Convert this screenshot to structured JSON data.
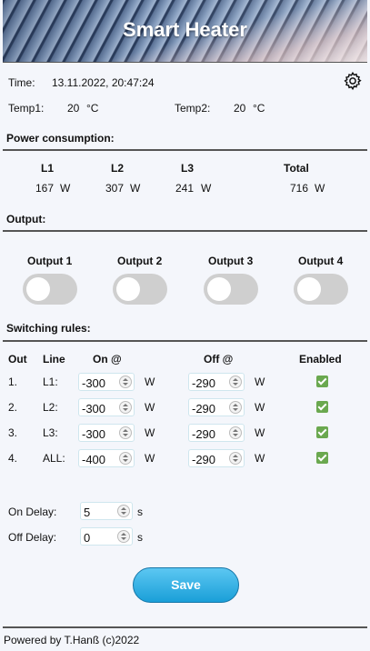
{
  "header": {
    "title": "Smart Heater"
  },
  "info": {
    "time_label": "Time:",
    "time_value": "13.11.2022, 20:47:24",
    "temp1_label": "Temp1:",
    "temp1_value": "20",
    "temp1_unit": "°C",
    "temp2_label": "Temp2:",
    "temp2_value": "20",
    "temp2_unit": "°C",
    "settings_icon": "gear-icon"
  },
  "power": {
    "section_label": "Power consumption:",
    "columns": [
      {
        "label": "L1",
        "value": "167",
        "unit": "W"
      },
      {
        "label": "L2",
        "value": "307",
        "unit": "W"
      },
      {
        "label": "L3",
        "value": "241",
        "unit": "W"
      },
      {
        "label": "Total",
        "value": "716",
        "unit": "W"
      }
    ]
  },
  "output": {
    "section_label": "Output:",
    "items": [
      {
        "label": "Output 1",
        "on": false
      },
      {
        "label": "Output 2",
        "on": false
      },
      {
        "label": "Output 3",
        "on": false
      },
      {
        "label": "Output 4",
        "on": false
      }
    ]
  },
  "rules": {
    "section_label": "Switching rules:",
    "headers": {
      "out": "Out",
      "line": "Line",
      "on": "On @",
      "off": "Off @",
      "enabled": "Enabled"
    },
    "unit": "W",
    "rows": [
      {
        "out": "1.",
        "line": "L1:",
        "on": "-300",
        "off": "-290",
        "enabled": true
      },
      {
        "out": "2.",
        "line": "L2:",
        "on": "-300",
        "off": "-290",
        "enabled": true
      },
      {
        "out": "3.",
        "line": "L3:",
        "on": "-300",
        "off": "-290",
        "enabled": true
      },
      {
        "out": "4.",
        "line": "ALL:",
        "on": "-400",
        "off": "-290",
        "enabled": true
      }
    ]
  },
  "delays": {
    "on_label": "On Delay:",
    "on_value": "5",
    "off_label": "Off Delay:",
    "off_value": "0",
    "unit": "s"
  },
  "save_label": "Save",
  "footer": "Powered by T.Hanß (c)2022",
  "colors": {
    "accent": "#1a9fd8",
    "check": "#6aa84f",
    "toggle_off": "#cfcfcf"
  }
}
